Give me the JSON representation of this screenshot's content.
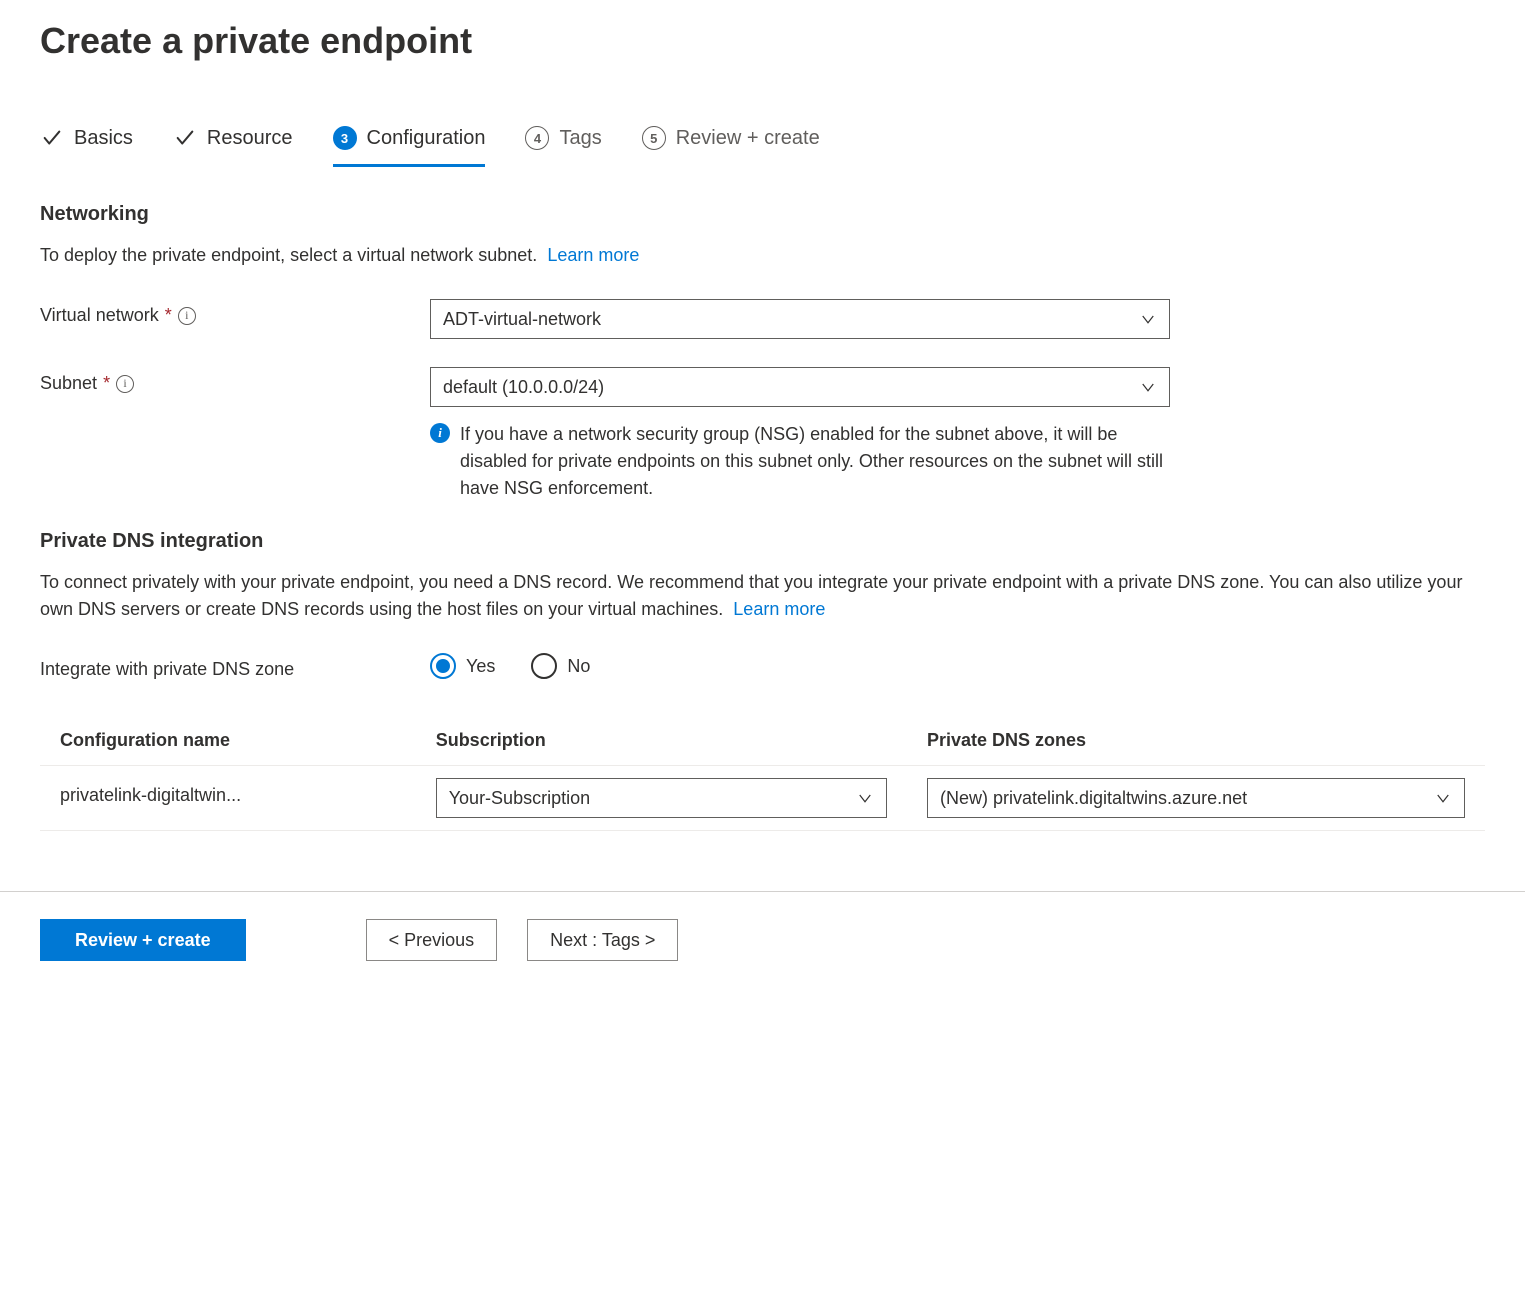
{
  "title": "Create a private endpoint",
  "tabs": [
    {
      "label": "Basics",
      "state": "done"
    },
    {
      "label": "Resource",
      "state": "done"
    },
    {
      "label": "Configuration",
      "state": "current",
      "step": "3"
    },
    {
      "label": "Tags",
      "state": "future",
      "step": "4"
    },
    {
      "label": "Review + create",
      "state": "future",
      "step": "5"
    }
  ],
  "networking": {
    "heading": "Networking",
    "desc": "To deploy the private endpoint, select a virtual network subnet.",
    "learn_more": "Learn more",
    "vnet_label": "Virtual network",
    "vnet_value": "ADT-virtual-network",
    "subnet_label": "Subnet",
    "subnet_value": "default (10.0.0.0/24)",
    "subnet_info": "If you have a network security group (NSG) enabled for the subnet above, it will be disabled for private endpoints on this subnet only. Other resources on the subnet will still have NSG enforcement."
  },
  "dns": {
    "heading": "Private DNS integration",
    "desc": "To connect privately with your private endpoint, you need a DNS record. We recommend that you integrate your private endpoint with a private DNS zone. You can also utilize your own DNS servers or create DNS records using the host files on your virtual machines.",
    "learn_more": "Learn more",
    "integrate_label": "Integrate with private DNS zone",
    "option_yes": "Yes",
    "option_no": "No",
    "selected": "yes",
    "table": {
      "col_config": "Configuration name",
      "col_subscription": "Subscription",
      "col_zones": "Private DNS zones",
      "rows": [
        {
          "config_name": "privatelink-digitaltwin...",
          "subscription": "Your-Subscription",
          "zone": "(New) privatelink.digitaltwins.azure.net"
        }
      ]
    }
  },
  "footer": {
    "review": "Review + create",
    "previous": "< Previous",
    "next": "Next : Tags >"
  }
}
